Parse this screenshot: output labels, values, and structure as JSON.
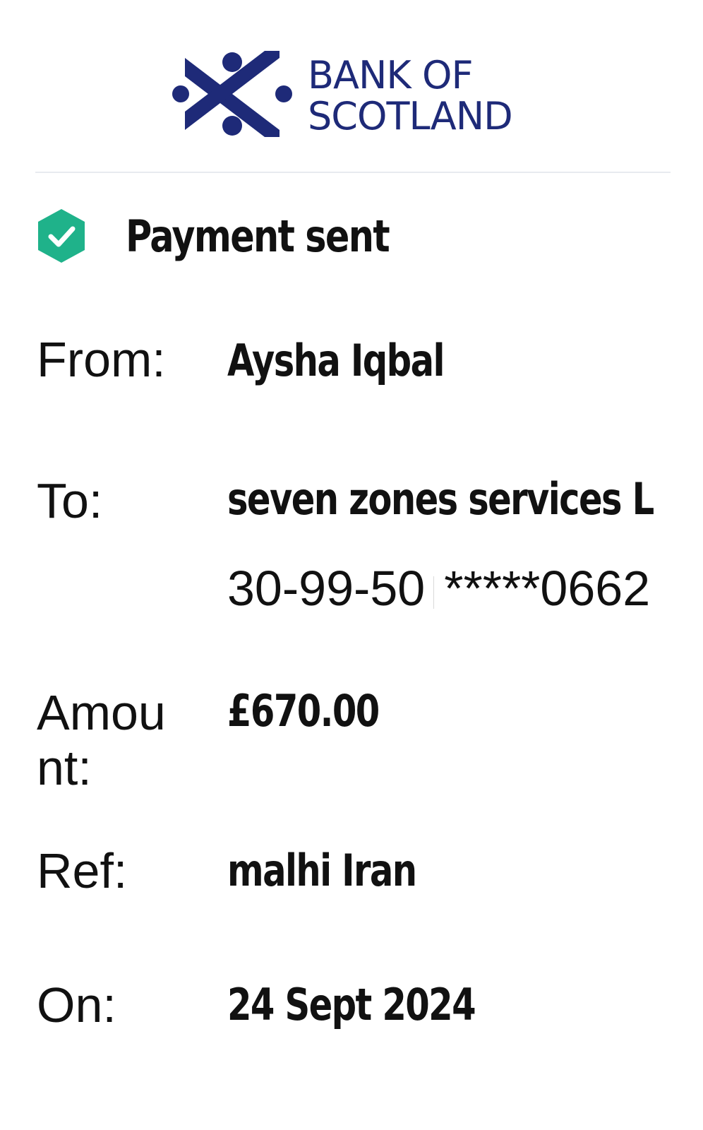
{
  "brand": {
    "line1": "BANK OF",
    "line2": "SCOTLAND",
    "color": "#1e2a78"
  },
  "status": {
    "title": "Payment sent",
    "icon": "check-shield-icon",
    "color": "#1fb28a"
  },
  "fields": {
    "from_label": "From:",
    "from_value": "Aysha Iqbal",
    "to_label": "To:",
    "to_value": "seven zones services L",
    "sort_code": "30-99-50",
    "account_masked": "*****0662",
    "amount_label": "Amount:",
    "amount_value": "£670.00",
    "ref_label": "Ref:",
    "ref_value": "malhi Iran",
    "on_label": "On:",
    "on_value": "24 Sept 2024"
  }
}
